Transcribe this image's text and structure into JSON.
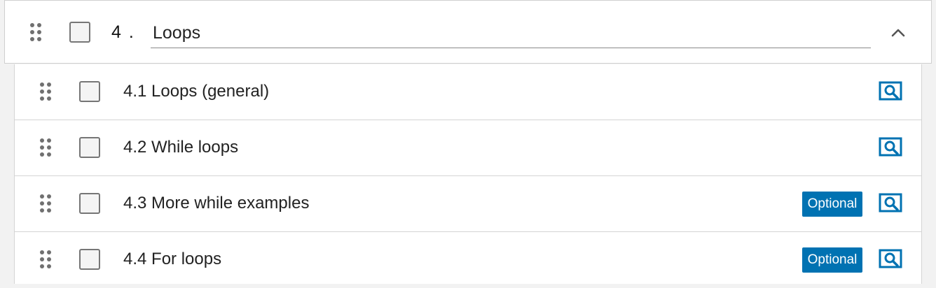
{
  "section": {
    "number": "4 .",
    "title": "Loops",
    "icons": {
      "drag": "drag-handle-icon",
      "collapse": "chevron-up-icon"
    }
  },
  "colors": {
    "accent": "#0072b2",
    "page_background": "#f2f2f2",
    "divider": "#d4d4d4"
  },
  "items": [
    {
      "label": "4.1 Loops (general)",
      "optional": false,
      "badge": ""
    },
    {
      "label": "4.2 While loops",
      "optional": false,
      "badge": ""
    },
    {
      "label": "4.3 More while examples",
      "optional": true,
      "badge": "Optional"
    },
    {
      "label": "4.4 For loops",
      "optional": true,
      "badge": "Optional"
    }
  ],
  "item_icons": {
    "drag": "drag-handle-icon",
    "preview": "preview-search-icon"
  }
}
